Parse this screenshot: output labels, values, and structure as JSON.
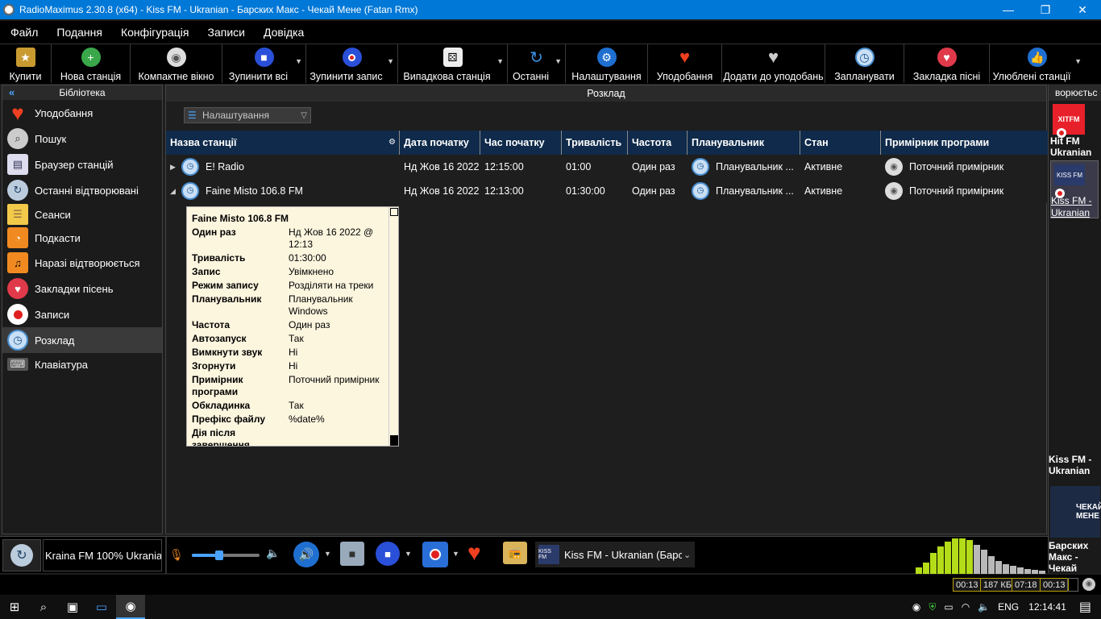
{
  "window": {
    "title": "RadioMaximus 2.30.8 (x64) - Kiss FM - Ukranian - Барских Макс - Чекай Мене (Fatan Rmx)",
    "minimize": "—",
    "restore": "❐",
    "close": "✕"
  },
  "menu": [
    "Файл",
    "Подання",
    "Конфігурація",
    "Записи",
    "Довідка"
  ],
  "toolbar": {
    "buy": "Купити",
    "new_station": "Нова станція",
    "compact": "Компактне вікно",
    "stop_all": "Зупинити всі",
    "stop_record": "Зупинити запис",
    "random_station": "Випадкова станція",
    "recent": "Останні",
    "settings": "Налаштування",
    "favorites": "Уподобання",
    "add_favorites": "Додати до уподобань",
    "schedule": "Запланувати",
    "bookmark_song": "Закладка пісні",
    "fav_stations": "Улюблені станції"
  },
  "library": {
    "header": "Бібліотека",
    "items": [
      {
        "label": "Уподобання",
        "icon": "heart-icon"
      },
      {
        "label": "Пошук",
        "icon": "search-icon"
      },
      {
        "label": "Браузер станцій",
        "icon": "browser-icon"
      },
      {
        "label": "Останні відтворювані",
        "icon": "recent-icon"
      },
      {
        "label": "Сеанси",
        "icon": "sessions-icon"
      },
      {
        "label": "Подкасти",
        "icon": "podcast-icon"
      },
      {
        "label": "Наразі відтворюється",
        "icon": "now-playing-icon"
      },
      {
        "label": "Закладки пісень",
        "icon": "bookmark-icon"
      },
      {
        "label": "Записи",
        "icon": "record-icon"
      },
      {
        "label": "Розклад",
        "icon": "clock-icon"
      },
      {
        "label": "Клавіатура",
        "icon": "keyboard-icon"
      }
    ]
  },
  "schedule": {
    "header": "Розклад",
    "settings_dropdown": "Налаштування",
    "columns": [
      "Назва станції",
      "Дата початку",
      "Час початку",
      "Тривалість",
      "Частота",
      "Планувальник",
      "Стан",
      "Примірник програми"
    ],
    "rows": [
      {
        "expander": "▶",
        "station": "E! Radio",
        "date": "Нд Жов 16 2022",
        "time": "12:15:00",
        "duration": "01:00",
        "frequency": "Один раз",
        "scheduler": "Планувальник ...",
        "state": "Активне",
        "instance": "Поточний примірник"
      },
      {
        "expander": "◢",
        "station": "Faine Misto 106.8 FM",
        "date": "Нд Жов 16 2022",
        "time": "12:13:00",
        "duration": "01:30:00",
        "frequency": "Один раз",
        "scheduler": "Планувальник ...",
        "state": "Активне",
        "instance": "Поточний примірник"
      }
    ]
  },
  "tooltip": {
    "title": "Faine Misto 106.8 FM",
    "fields": [
      {
        "k": "Один раз",
        "v": "Нд Жов 16 2022 @ 12:13"
      },
      {
        "k": "Тривалість",
        "v": "01:30:00"
      },
      {
        "k": "Запис",
        "v": "Увімкнено"
      },
      {
        "k": "Режим запису",
        "v": "Розділяти на треки"
      },
      {
        "k": "Планувальник",
        "v": "Планувальник Windows"
      },
      {
        "k": "Частота",
        "v": "Один раз"
      },
      {
        "k": "Автозапуск",
        "v": "Так"
      },
      {
        "k": "Вимкнути звук",
        "v": "Ні"
      },
      {
        "k": "Згорнути",
        "v": "Ні"
      },
      {
        "k": "Примірник програми",
        "v": "Поточний примірник"
      },
      {
        "k": "Обкладинка",
        "v": "Так"
      },
      {
        "k": "Префікс файлу",
        "v": "%date%"
      },
      {
        "k": "Дія після завершення",
        "v": ""
      }
    ]
  },
  "right_panel": {
    "header": "ворюєтьс",
    "station1": "Hit FM Ukranian",
    "station1_logo": "ХІТFM",
    "station2": "Kiss FM - Ukranian",
    "station2_logo": "KISS FM",
    "now_station": "Kiss FM - Ukranian",
    "now_artist": "Барских Макс - Чекай",
    "cover_text": "ЧЕКАЙ МЕНЕ"
  },
  "player": {
    "station": "Kraina FM 100% Ukranian",
    "now_playing": "Kiss FM - Ukranian (Барск",
    "now_playing_logo": "KISS FM",
    "volume": 0.4
  },
  "status": {
    "elapsed": "00:13",
    "size": "187 КБ",
    "time": "07:18",
    "remaining": "00:13"
  },
  "taskbar": {
    "lang": "ENG",
    "clock": "12:14:41"
  },
  "colors": {
    "accent": "#0078d7",
    "header_blue": "#0f2a4a",
    "tooltip_bg": "#fdf6df",
    "eq_green": "#b4dc18"
  }
}
